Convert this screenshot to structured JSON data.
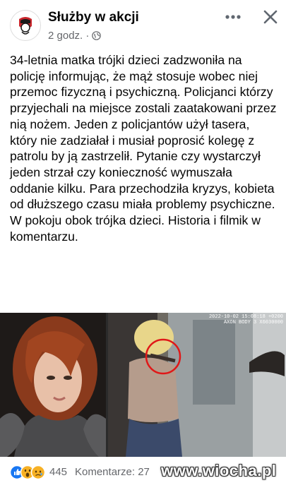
{
  "post": {
    "page_name": "Służby w akcji",
    "time": "2 godz. ·",
    "privacy_icon": "globe-icon",
    "body": "34-letnia matka trójki dzieci zadzwoniła na policję informując, że mąż stosuje wobec niej przemoc fizyczną i psychiczną. Policjanci którzy przyjechali na miejsce zostali zaatakowani przez nią nożem. Jeden z policjantów użył tasera, który nie zadziałał i musiał poprosić kolegę z patrolu by ją zastrzelił. Pytanie czy wystarczył jeden strzał czy konieczność wymuszała oddanie kilku. Para przechodziła kryzys, kobieta od dłuższego czasu miała problemy psychiczne. W pokoju obok trójka dzieci. Historia i filmik w komentarzu.",
    "more_icon": "more-horizontal-icon",
    "close_icon": "close-icon"
  },
  "media": {
    "left_image": "woman-portrait-photo",
    "right_image": "bodycam-still-with-red-circle",
    "timestamp": "2022-10-02 15:08:18 +0200\nAXON BODY 3 X6030000"
  },
  "footer": {
    "reactions": [
      "like-icon",
      "wow-icon",
      "sad-icon"
    ],
    "reaction_count": "445",
    "comments": "Komentarze: 27",
    "watermark": "www.wiocha.pl"
  }
}
